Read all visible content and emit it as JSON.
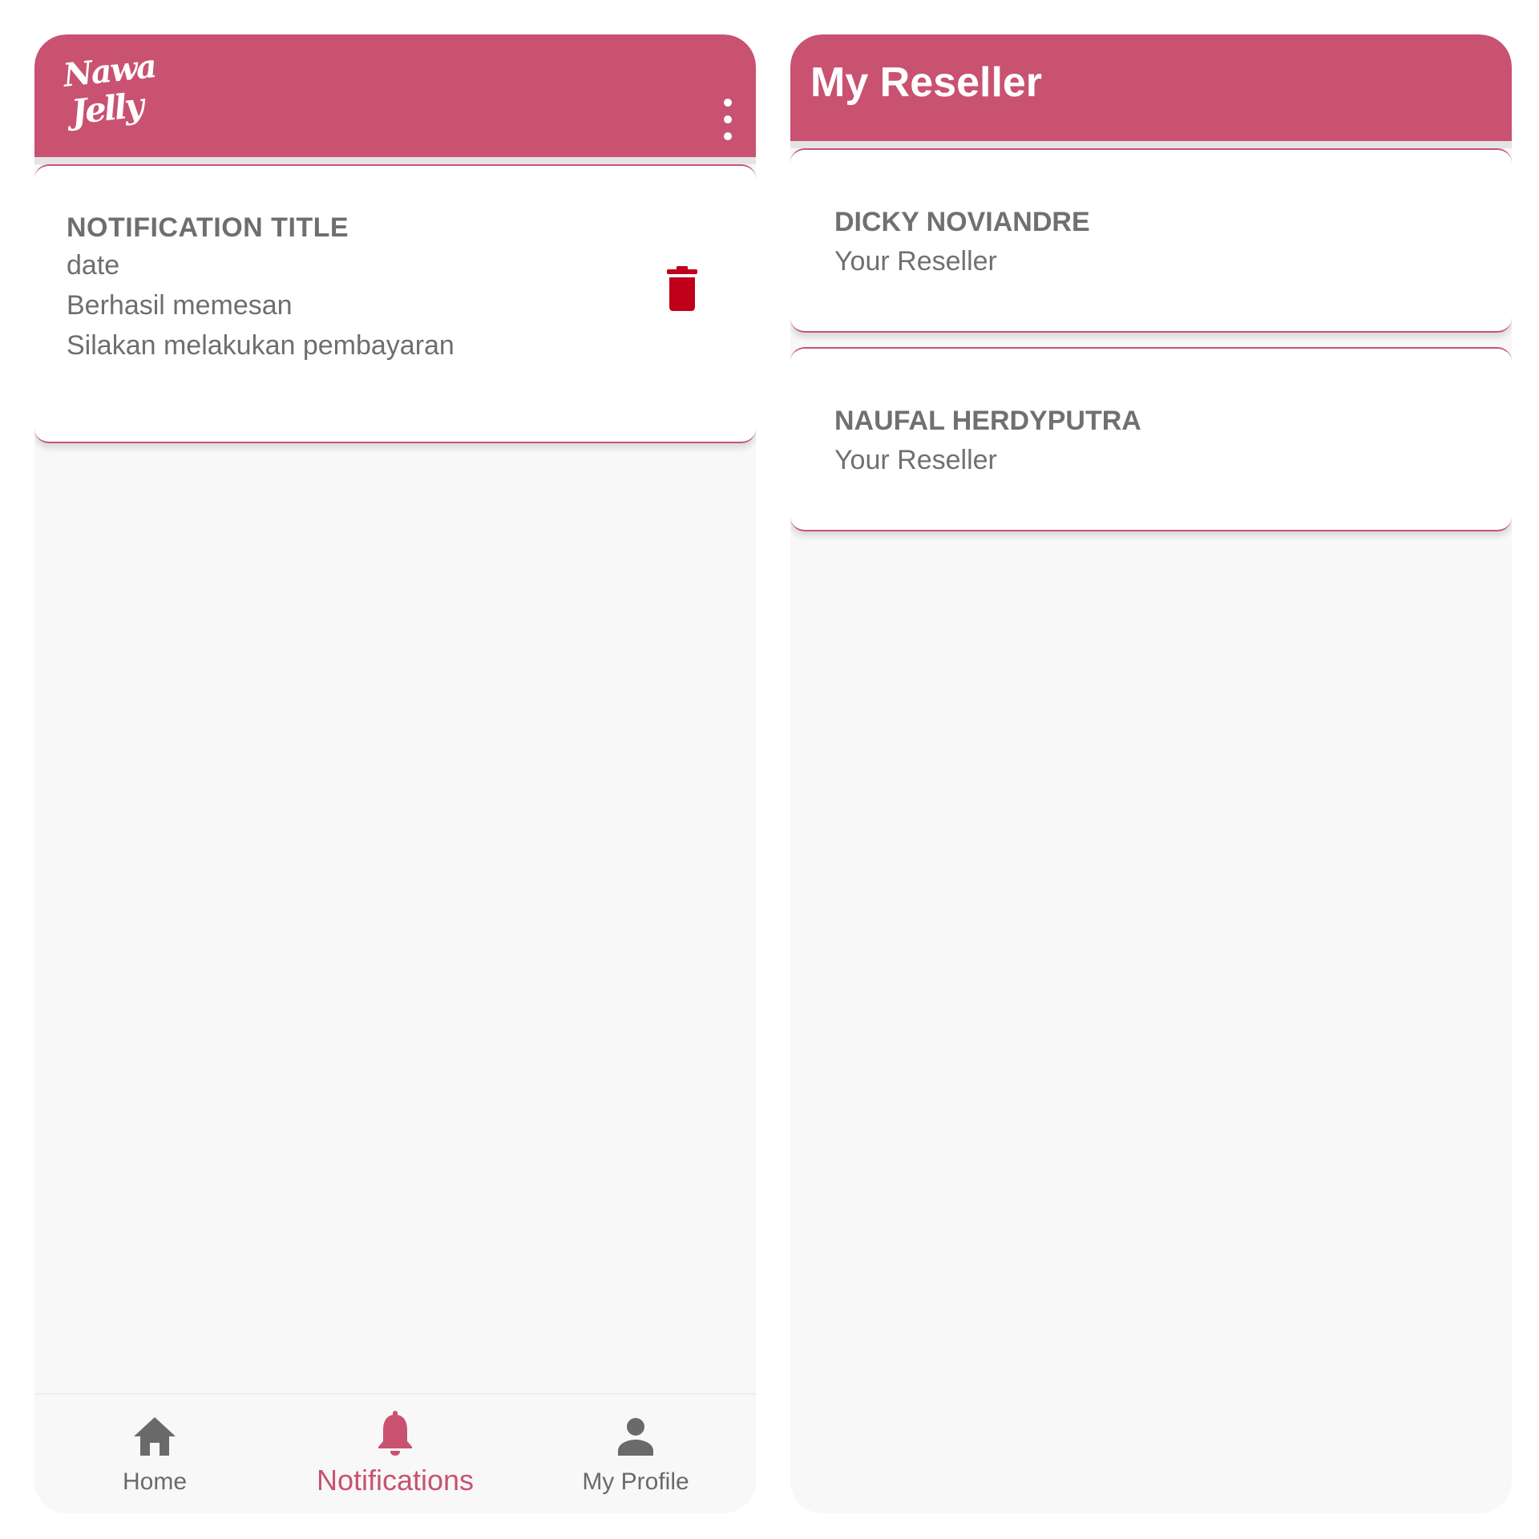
{
  "colors": {
    "accent": "#c95271",
    "delete": "#c0001a",
    "text_muted": "#707070",
    "background": "#f8f8f8"
  },
  "notifications_screen": {
    "logo": {
      "line1": "Nawa",
      "line2": "Jelly"
    },
    "more_menu_icon": "more-vert-icon",
    "notification": {
      "title": "NOTIFICATION TITLE",
      "date": "date",
      "line1": "Berhasil memesan",
      "line2": "Silakan melakukan pembayaran",
      "delete_icon": "trash-icon"
    },
    "bottom_nav": [
      {
        "label": "Home",
        "icon": "home-icon",
        "active": false
      },
      {
        "label": "Notifications",
        "icon": "bell-icon",
        "active": true
      },
      {
        "label": "My Profile",
        "icon": "person-icon",
        "active": false
      }
    ]
  },
  "reseller_screen": {
    "title": "My Reseller",
    "resellers": [
      {
        "name": "DICKY NOVIANDRE",
        "role": "Your Reseller"
      },
      {
        "name": "NAUFAL HERDYPUTRA",
        "role": "Your Reseller"
      }
    ]
  }
}
